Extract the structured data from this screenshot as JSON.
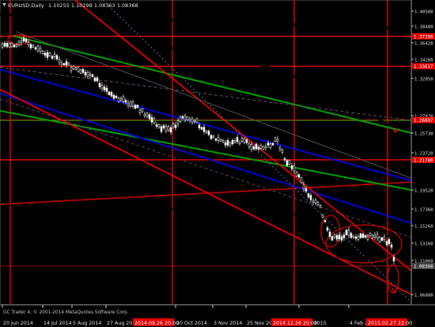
{
  "app": {
    "symbol_header": "EURUSD,Daily",
    "ohlc_header": "1.10255 1.10298 1.08363 1.08368",
    "copyright": "GC Trader 4, © 2001-2014 MetaQuotes Software Corp."
  },
  "colors": {
    "background": "#000000",
    "candle": "#ffffff",
    "red": "#ff0000",
    "dark_red": "#a00000",
    "green": "#00a000",
    "blue": "#0000c8",
    "black_line": "#000000",
    "grey_dashed": "#606080",
    "price_tag_red": "#e00000",
    "price_tag_current": "#404040"
  },
  "price_axis": {
    "labels": [
      "1.40580",
      "1.38480",
      "1.36420",
      "1.34280",
      "1.32050",
      "1.27920",
      "1.25730",
      "1.23720",
      "1.19520",
      "1.17360",
      "1.15260",
      "1.13160",
      "1.11060",
      "1.06880",
      "1.04760"
    ],
    "tags": [
      {
        "label": "1.37390",
        "type": "level"
      },
      {
        "label": "1.33617",
        "type": "level"
      },
      {
        "label": "1.26807",
        "type": "level"
      },
      {
        "label": "1.21780",
        "type": "level"
      },
      {
        "label": "1.08368",
        "type": "current"
      }
    ]
  },
  "time_axis": {
    "labels": [
      "20 Jun 2014",
      "14 Jul 2014",
      "5 Aug 2014",
      "27 Aug 2014",
      "20 Oct 2014",
      "3 Nov 2014",
      "25 Nov 2014",
      "3 Jan 2015",
      "4 Feb 2015"
    ],
    "tags": [
      "2014.09.26 20:00",
      "2014.12.26 20:00",
      "2015.02.27 22:00"
    ]
  },
  "chart_data": {
    "type": "line",
    "symbol": "EURUSD",
    "timeframe": "Daily",
    "ohlc": {
      "open": 1.10255,
      "high": 1.10298,
      "low": 1.08363,
      "close": 1.08368
    },
    "ylim": [
      1.0476,
      1.4058
    ],
    "horizontal_levels": [
      1.3739,
      1.33617,
      1.26807,
      1.2178,
      1.08368
    ],
    "marked_dates": [
      "2014.09.26 20:00",
      "2014.12.26 20:00",
      "2015.02.27 22:00"
    ]
  }
}
